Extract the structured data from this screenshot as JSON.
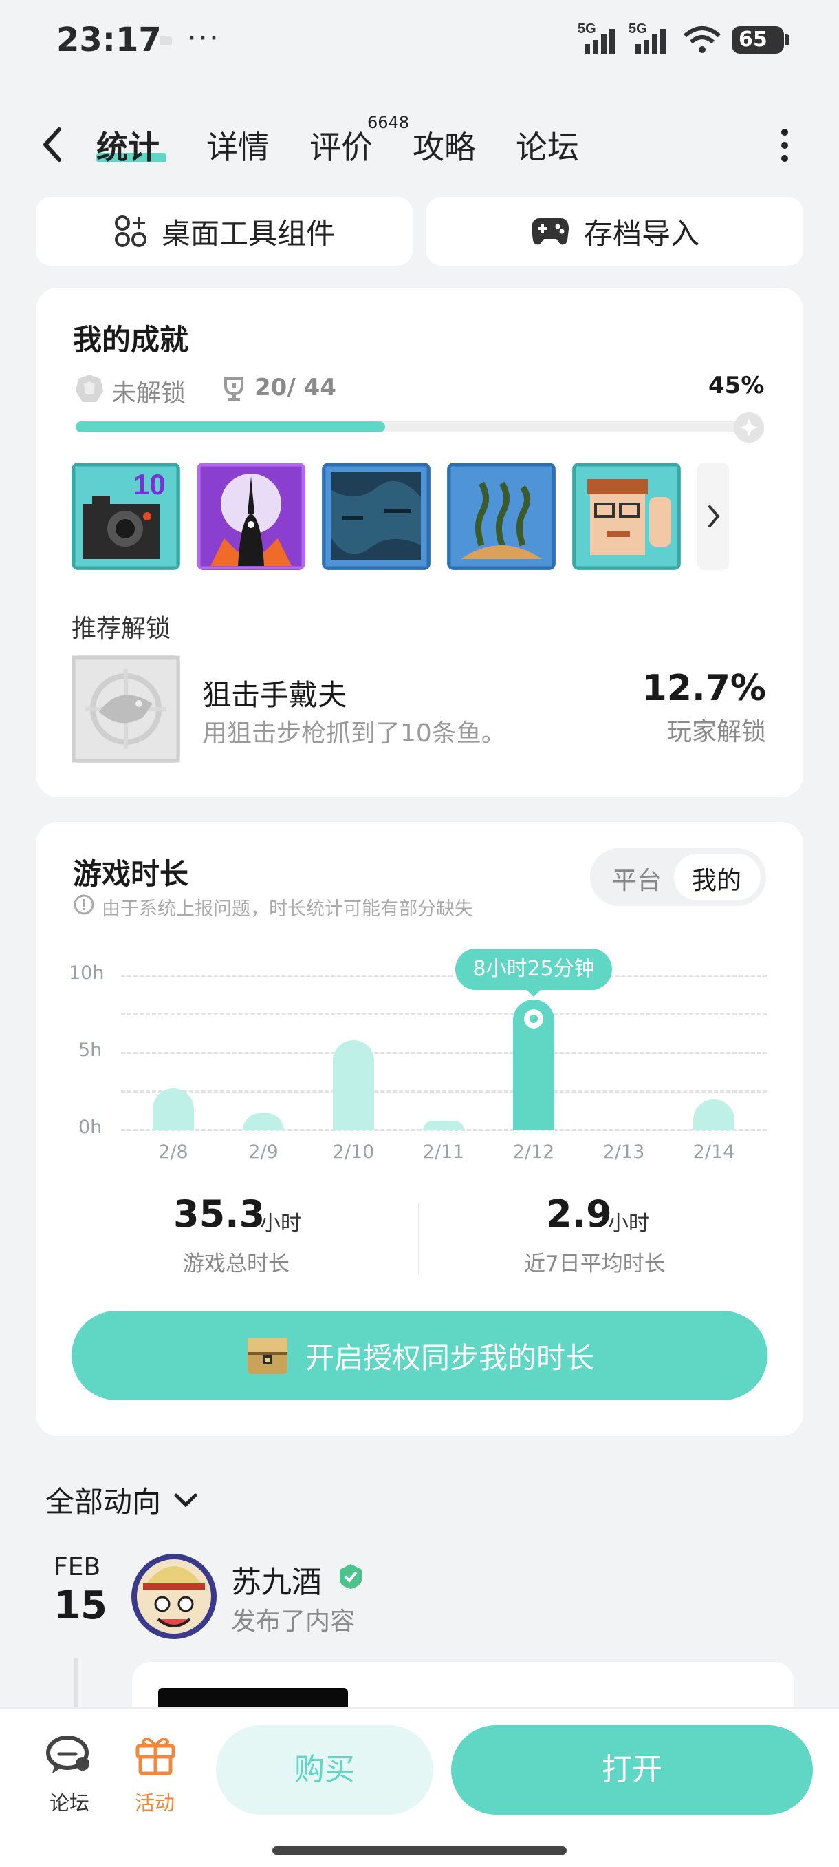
{
  "status_bar": {
    "time": "23:17",
    "dots": "···",
    "signal1": "5G",
    "signal2": "5G",
    "battery": "65"
  },
  "nav": {
    "tabs": [
      {
        "label": "统计",
        "active": true
      },
      {
        "label": "详情"
      },
      {
        "label": "评价"
      },
      {
        "label": "攻略"
      },
      {
        "label": "论坛"
      }
    ],
    "review_count": "6648"
  },
  "top_buttons": {
    "widget": "桌面工具组件",
    "save_import": "存档导入"
  },
  "achievements": {
    "title": "我的成就",
    "locked_label": "未解锁",
    "progress_text": "20/ 44",
    "percent": "45%",
    "progress_fraction": 0.45,
    "badge_number": "10"
  },
  "recommend": {
    "title": "推荐解锁",
    "name": "狙击手戴夫",
    "desc": "用狙击步枪抓到了10条鱼。",
    "rate": "12.7%",
    "rate_label": "玩家解锁"
  },
  "playtime": {
    "title": "游戏时长",
    "notice": "由于系统上报问题，时长统计可能有部分缺失",
    "toggle": [
      "平台",
      "我的"
    ],
    "tooltip": "8小时25分钟",
    "total_value": "35.3",
    "total_unit": "小时",
    "total_label": "游戏总时长",
    "avg_value": "2.9",
    "avg_unit": "小时",
    "avg_label": "近7日平均时长",
    "sync_button": "开启授权同步我的时长"
  },
  "chart_data": {
    "type": "bar",
    "categories": [
      "2/8",
      "2/9",
      "2/10",
      "2/11",
      "2/12",
      "2/13",
      "2/14"
    ],
    "values": [
      2.7,
      1.1,
      5.8,
      0.6,
      8.42,
      0,
      2.0
    ],
    "highlight_index": 4,
    "y_ticks": [
      "10h",
      "5h",
      "0h"
    ],
    "ylim": [
      0,
      10
    ],
    "colors": {
      "bar": "#bff0e8",
      "highlight": "#5fd7c4"
    }
  },
  "feed": {
    "filter": "全部动向",
    "month": "FEB",
    "day": "15",
    "user": "苏九酒",
    "action": "发布了内容"
  },
  "bottom": {
    "forum": "论坛",
    "activity": "活动",
    "buy": "购买",
    "open": "打开"
  },
  "colors": {
    "accent": "#5fd7c4",
    "orange": "#f4873c",
    "buy_bg": "#e4f7f4",
    "buy_text": "#5fd7c4"
  }
}
